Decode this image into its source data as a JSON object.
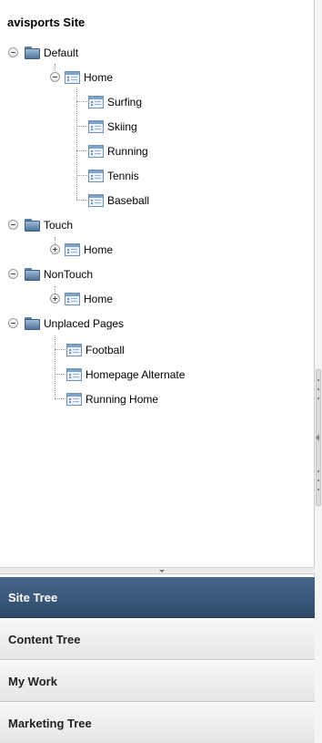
{
  "site": {
    "title": "avisports Site"
  },
  "tree": {
    "default": {
      "label": "Default",
      "home": {
        "label": "Home",
        "children": [
          "Surfing",
          "Skiing",
          "Running",
          "Tennis",
          "Baseball"
        ]
      }
    },
    "touch": {
      "label": "Touch",
      "home": "Home"
    },
    "nontouch": {
      "label": "NonTouch",
      "home": "Home"
    },
    "unplaced": {
      "label": "Unplaced Pages",
      "children": [
        "Football",
        "Homepage Alternate",
        "Running Home"
      ]
    }
  },
  "nav": {
    "site_tree": "Site Tree",
    "content_tree": "Content Tree",
    "my_work": "My Work",
    "marketing_tree": "Marketing Tree"
  },
  "colors": {
    "active_nav": "#3b5878",
    "folder_blue": "#5c7fa3"
  },
  "icons": {
    "folder": "folder-icon",
    "page": "page-icon",
    "collapse": "collapse-toggle-icon",
    "expand": "expand-toggle-icon"
  }
}
